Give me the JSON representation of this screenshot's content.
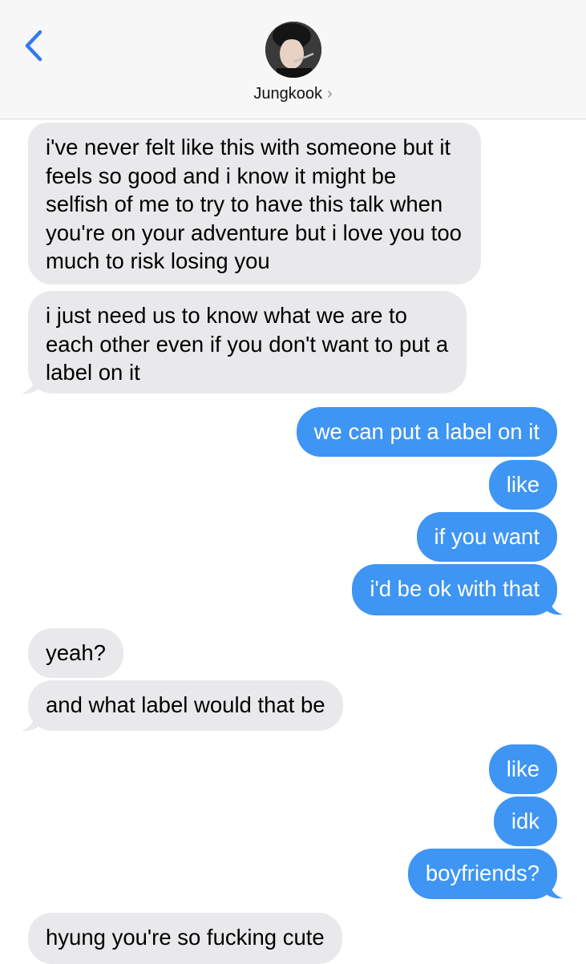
{
  "header": {
    "contact_name": "Jungkook",
    "chevron": "›",
    "back_icon": "chevron-left-icon",
    "accent": "#3478f6"
  },
  "colors": {
    "incoming_bubble": "#e9e9eb",
    "outgoing_bubble": "#3e95f3",
    "header_bg": "#f7f7f7"
  },
  "messages": [
    {
      "from": "them",
      "text": "i've never felt like this with someone but it feels so good and i know it might be selfish of me to try to have this talk when you're on your adventure but i love you too much to risk losing you"
    },
    {
      "from": "them",
      "text": "i just need us to know what we are to each other even if you don't want to put a label on it"
    },
    {
      "from": "me",
      "text": "we can put a label on it"
    },
    {
      "from": "me",
      "text": "like"
    },
    {
      "from": "me",
      "text": "if you want"
    },
    {
      "from": "me",
      "text": "i'd be ok with that"
    },
    {
      "from": "them",
      "text": "yeah?"
    },
    {
      "from": "them",
      "text": "and what label would that be"
    },
    {
      "from": "me",
      "text": "like"
    },
    {
      "from": "me",
      "text": "idk"
    },
    {
      "from": "me",
      "text": "boyfriends?"
    },
    {
      "from": "them",
      "text": "hyung you're so fucking cute"
    }
  ]
}
